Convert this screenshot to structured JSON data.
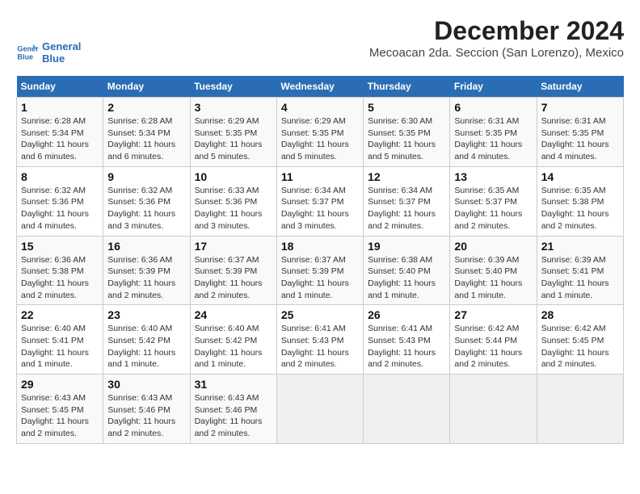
{
  "header": {
    "logo_line1": "General",
    "logo_line2": "Blue",
    "month": "December 2024",
    "location": "Mecoacan 2da. Seccion (San Lorenzo), Mexico"
  },
  "weekdays": [
    "Sunday",
    "Monday",
    "Tuesday",
    "Wednesday",
    "Thursday",
    "Friday",
    "Saturday"
  ],
  "weeks": [
    [
      {
        "day": "1",
        "detail": "Sunrise: 6:28 AM\nSunset: 5:34 PM\nDaylight: 11 hours\nand 6 minutes."
      },
      {
        "day": "2",
        "detail": "Sunrise: 6:28 AM\nSunset: 5:34 PM\nDaylight: 11 hours\nand 6 minutes."
      },
      {
        "day": "3",
        "detail": "Sunrise: 6:29 AM\nSunset: 5:35 PM\nDaylight: 11 hours\nand 5 minutes."
      },
      {
        "day": "4",
        "detail": "Sunrise: 6:29 AM\nSunset: 5:35 PM\nDaylight: 11 hours\nand 5 minutes."
      },
      {
        "day": "5",
        "detail": "Sunrise: 6:30 AM\nSunset: 5:35 PM\nDaylight: 11 hours\nand 5 minutes."
      },
      {
        "day": "6",
        "detail": "Sunrise: 6:31 AM\nSunset: 5:35 PM\nDaylight: 11 hours\nand 4 minutes."
      },
      {
        "day": "7",
        "detail": "Sunrise: 6:31 AM\nSunset: 5:35 PM\nDaylight: 11 hours\nand 4 minutes."
      }
    ],
    [
      {
        "day": "8",
        "detail": "Sunrise: 6:32 AM\nSunset: 5:36 PM\nDaylight: 11 hours\nand 4 minutes."
      },
      {
        "day": "9",
        "detail": "Sunrise: 6:32 AM\nSunset: 5:36 PM\nDaylight: 11 hours\nand 3 minutes."
      },
      {
        "day": "10",
        "detail": "Sunrise: 6:33 AM\nSunset: 5:36 PM\nDaylight: 11 hours\nand 3 minutes."
      },
      {
        "day": "11",
        "detail": "Sunrise: 6:34 AM\nSunset: 5:37 PM\nDaylight: 11 hours\nand 3 minutes."
      },
      {
        "day": "12",
        "detail": "Sunrise: 6:34 AM\nSunset: 5:37 PM\nDaylight: 11 hours\nand 2 minutes."
      },
      {
        "day": "13",
        "detail": "Sunrise: 6:35 AM\nSunset: 5:37 PM\nDaylight: 11 hours\nand 2 minutes."
      },
      {
        "day": "14",
        "detail": "Sunrise: 6:35 AM\nSunset: 5:38 PM\nDaylight: 11 hours\nand 2 minutes."
      }
    ],
    [
      {
        "day": "15",
        "detail": "Sunrise: 6:36 AM\nSunset: 5:38 PM\nDaylight: 11 hours\nand 2 minutes."
      },
      {
        "day": "16",
        "detail": "Sunrise: 6:36 AM\nSunset: 5:39 PM\nDaylight: 11 hours\nand 2 minutes."
      },
      {
        "day": "17",
        "detail": "Sunrise: 6:37 AM\nSunset: 5:39 PM\nDaylight: 11 hours\nand 2 minutes."
      },
      {
        "day": "18",
        "detail": "Sunrise: 6:37 AM\nSunset: 5:39 PM\nDaylight: 11 hours\nand 1 minute."
      },
      {
        "day": "19",
        "detail": "Sunrise: 6:38 AM\nSunset: 5:40 PM\nDaylight: 11 hours\nand 1 minute."
      },
      {
        "day": "20",
        "detail": "Sunrise: 6:39 AM\nSunset: 5:40 PM\nDaylight: 11 hours\nand 1 minute."
      },
      {
        "day": "21",
        "detail": "Sunrise: 6:39 AM\nSunset: 5:41 PM\nDaylight: 11 hours\nand 1 minute."
      }
    ],
    [
      {
        "day": "22",
        "detail": "Sunrise: 6:40 AM\nSunset: 5:41 PM\nDaylight: 11 hours\nand 1 minute."
      },
      {
        "day": "23",
        "detail": "Sunrise: 6:40 AM\nSunset: 5:42 PM\nDaylight: 11 hours\nand 1 minute."
      },
      {
        "day": "24",
        "detail": "Sunrise: 6:40 AM\nSunset: 5:42 PM\nDaylight: 11 hours\nand 1 minute."
      },
      {
        "day": "25",
        "detail": "Sunrise: 6:41 AM\nSunset: 5:43 PM\nDaylight: 11 hours\nand 2 minutes."
      },
      {
        "day": "26",
        "detail": "Sunrise: 6:41 AM\nSunset: 5:43 PM\nDaylight: 11 hours\nand 2 minutes."
      },
      {
        "day": "27",
        "detail": "Sunrise: 6:42 AM\nSunset: 5:44 PM\nDaylight: 11 hours\nand 2 minutes."
      },
      {
        "day": "28",
        "detail": "Sunrise: 6:42 AM\nSunset: 5:45 PM\nDaylight: 11 hours\nand 2 minutes."
      }
    ],
    [
      {
        "day": "29",
        "detail": "Sunrise: 6:43 AM\nSunset: 5:45 PM\nDaylight: 11 hours\nand 2 minutes."
      },
      {
        "day": "30",
        "detail": "Sunrise: 6:43 AM\nSunset: 5:46 PM\nDaylight: 11 hours\nand 2 minutes."
      },
      {
        "day": "31",
        "detail": "Sunrise: 6:43 AM\nSunset: 5:46 PM\nDaylight: 11 hours\nand 2 minutes."
      },
      null,
      null,
      null,
      null
    ]
  ]
}
